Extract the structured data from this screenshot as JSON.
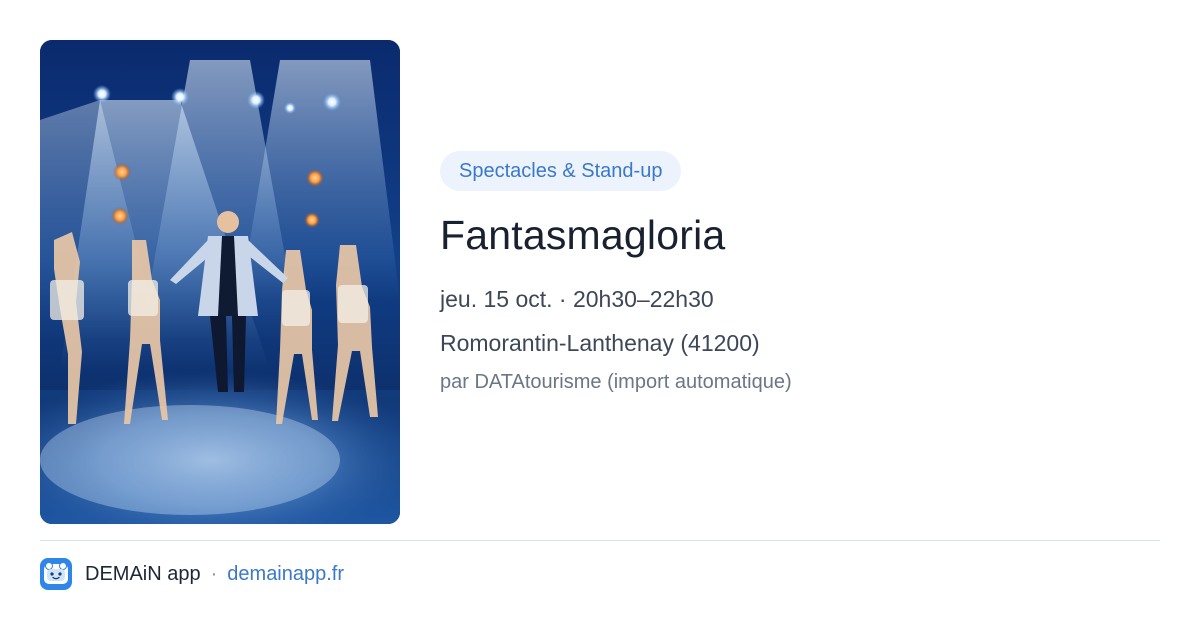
{
  "event": {
    "category": "Spectacles & Stand-up",
    "title": "Fantasmagloria",
    "datetime": "jeu. 15 oct. · 20h30–22h30",
    "location": "Romorantin-Lanthenay (41200)",
    "source": "par DATAtourisme (import automatique)",
    "image_alt": "Stage show with performer and dancers under blue spotlights"
  },
  "footer": {
    "app_name": "DEMAiN app",
    "separator": "·",
    "url": "demainapp.fr",
    "logo_icon": "demain-app-logo-icon"
  },
  "colors": {
    "accent": "#3a78c9",
    "pill_background": "#edf3fc",
    "logo_blue": "#2f86e6"
  }
}
